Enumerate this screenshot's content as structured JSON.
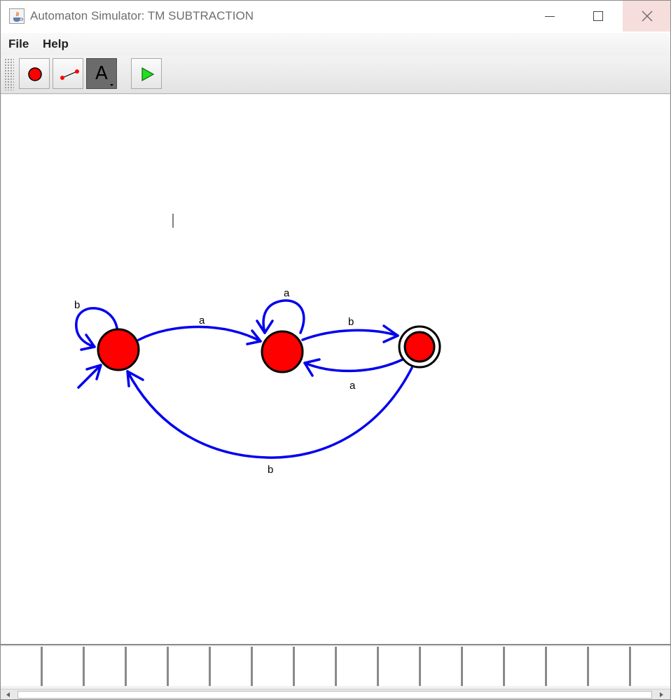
{
  "window": {
    "title": "Automaton Simulator: TM SUBTRACTION",
    "app_icon": "java-cup-icon"
  },
  "menu": {
    "items": [
      {
        "label": "File"
      },
      {
        "label": "Help"
      }
    ]
  },
  "toolbar": {
    "tools": [
      {
        "name": "state-tool",
        "icon": "red-circle-icon",
        "selected": false
      },
      {
        "name": "transition-tool",
        "icon": "transition-line-icon",
        "selected": false
      },
      {
        "name": "label-tool",
        "glyph": "A",
        "icon": "text-label-icon",
        "selected": true
      },
      {
        "name": "run-tool",
        "icon": "green-play-icon",
        "selected": false
      }
    ]
  },
  "automaton": {
    "states": [
      {
        "id": "q0",
        "initial": true,
        "accepting": false
      },
      {
        "id": "q1",
        "initial": false,
        "accepting": false
      },
      {
        "id": "q2",
        "initial": false,
        "accepting": true
      }
    ],
    "transitions": [
      {
        "from": "q0",
        "to": "q0",
        "symbol": "b"
      },
      {
        "from": "q0",
        "to": "q1",
        "symbol": "a"
      },
      {
        "from": "q1",
        "to": "q1",
        "symbol": "a"
      },
      {
        "from": "q1",
        "to": "q2",
        "symbol": "b"
      },
      {
        "from": "q2",
        "to": "q1",
        "symbol": "a"
      },
      {
        "from": "q2",
        "to": "q0",
        "symbol": "b"
      }
    ],
    "colors": {
      "state_fill": "#ff0000",
      "edge": "#0000ee"
    }
  },
  "tape": {
    "cells": [
      "",
      "",
      "",
      "",
      "",
      "",
      "",
      "",
      "",
      "",
      "",
      "",
      "",
      "",
      "",
      "",
      ""
    ]
  }
}
